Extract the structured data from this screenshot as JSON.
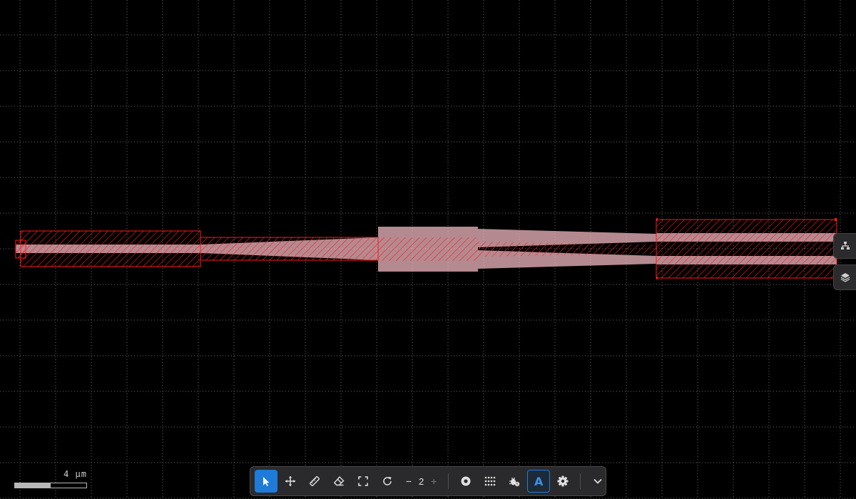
{
  "canvas": {
    "background": "#000000",
    "grid_color": "#6a6a6a",
    "layer_color": "#ff1a1a",
    "fill_color": "#f0b8c0"
  },
  "scale_bar": {
    "label": "4 µm",
    "fill_fraction": 0.5
  },
  "side_panels": [
    {
      "icon": "hierarchy-icon"
    },
    {
      "icon": "layers-icon"
    }
  ],
  "toolbar": {
    "tools": [
      {
        "icon": "pointer-icon",
        "active": true
      },
      {
        "icon": "move-icon"
      },
      {
        "icon": "ruler-icon"
      },
      {
        "icon": "eraser-icon"
      },
      {
        "icon": "fit-view-icon"
      },
      {
        "icon": "rotate-icon"
      }
    ],
    "stepper": {
      "minus": "−",
      "value": "2",
      "plus": "+"
    },
    "options": [
      {
        "icon": "record-icon"
      },
      {
        "icon": "grid-icon"
      },
      {
        "icon": "bug-icon"
      },
      {
        "icon": "text-icon",
        "label": "A",
        "active": true
      },
      {
        "icon": "settings-icon"
      },
      {
        "icon": "chevron-down-icon"
      }
    ],
    "accent": "#1e7bd9"
  }
}
